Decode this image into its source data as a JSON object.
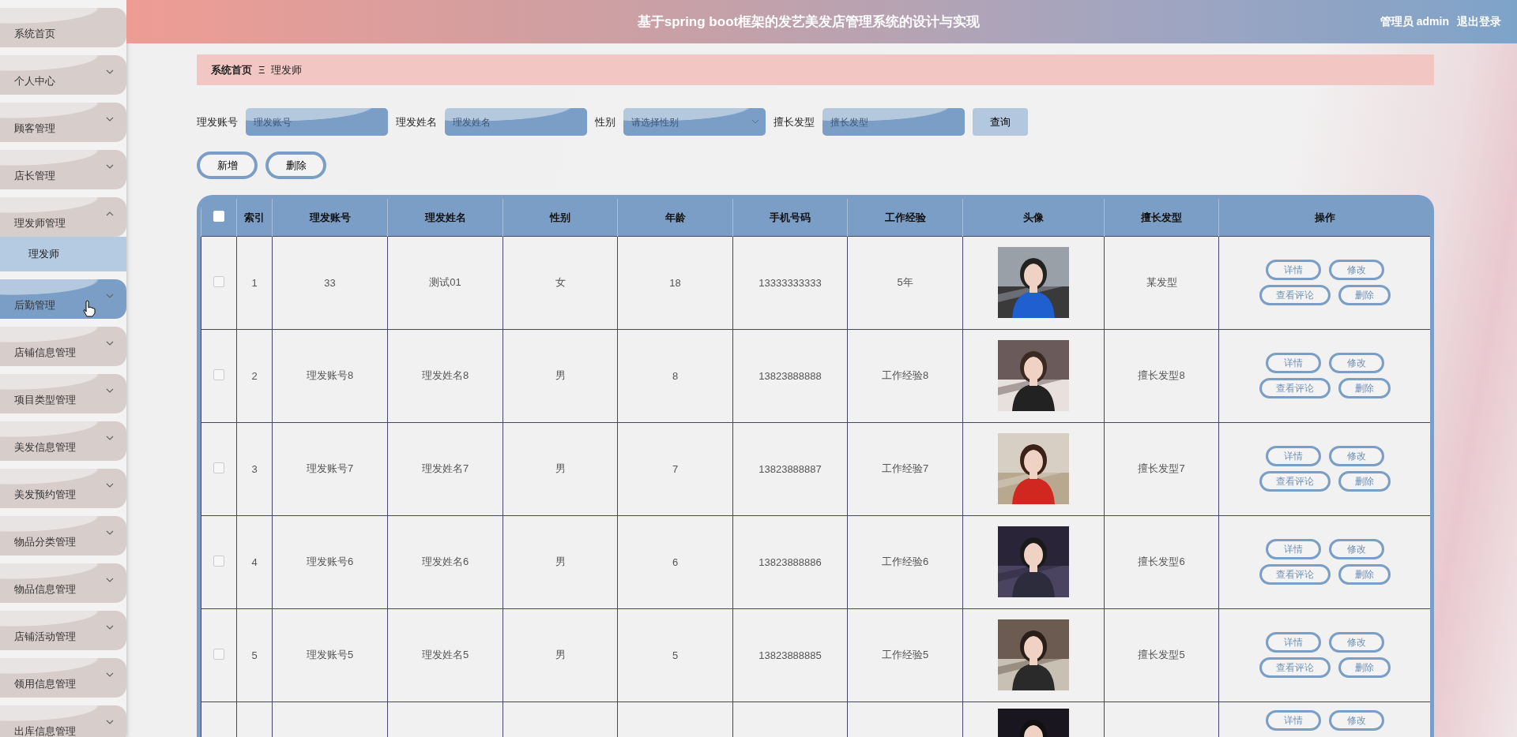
{
  "header": {
    "title": "基于spring boot框架的发艺美发店管理系统的设计与实现",
    "user": "管理员 admin",
    "logout": "退出登录"
  },
  "sidebar": {
    "items": [
      {
        "label": "系统首页",
        "kind": "link",
        "hovered": false
      },
      {
        "label": "个人中心",
        "kind": "menu",
        "expanded": false,
        "hovered": false
      },
      {
        "label": "顾客管理",
        "kind": "menu",
        "expanded": false,
        "hovered": false
      },
      {
        "label": "店长管理",
        "kind": "menu",
        "expanded": false,
        "hovered": false
      },
      {
        "label": "理发师管理",
        "kind": "menu",
        "expanded": true,
        "hovered": false,
        "children": [
          {
            "label": "理发师",
            "selected": true
          }
        ]
      },
      {
        "label": "后勤管理",
        "kind": "menu",
        "expanded": false,
        "hovered": true
      },
      {
        "label": "店铺信息管理",
        "kind": "menu",
        "expanded": false,
        "hovered": false
      },
      {
        "label": "项目类型管理",
        "kind": "menu",
        "expanded": false,
        "hovered": false
      },
      {
        "label": "美发信息管理",
        "kind": "menu",
        "expanded": false,
        "hovered": false
      },
      {
        "label": "美发预约管理",
        "kind": "menu",
        "expanded": false,
        "hovered": false
      },
      {
        "label": "物品分类管理",
        "kind": "menu",
        "expanded": false,
        "hovered": false
      },
      {
        "label": "物品信息管理",
        "kind": "menu",
        "expanded": false,
        "hovered": false
      },
      {
        "label": "店铺活动管理",
        "kind": "menu",
        "expanded": false,
        "hovered": false
      },
      {
        "label": "领用信息管理",
        "kind": "menu",
        "expanded": false,
        "hovered": false
      },
      {
        "label": "出库信息管理",
        "kind": "menu",
        "expanded": false,
        "hovered": false
      }
    ]
  },
  "breadcrumb": {
    "items": [
      "系统首页",
      "理发师"
    ],
    "separator": "Ξ"
  },
  "search": {
    "fields": [
      {
        "label": "理发账号",
        "kind": "input",
        "placeholder": "理发账号"
      },
      {
        "label": "理发姓名",
        "kind": "input",
        "placeholder": "理发姓名"
      },
      {
        "label": "性别",
        "kind": "select",
        "placeholder": "请选择性别"
      },
      {
        "label": "擅长发型",
        "kind": "input",
        "placeholder": "擅长发型"
      }
    ],
    "button": "查询"
  },
  "actions": [
    "新增",
    "删除"
  ],
  "table": {
    "columns": [
      "索引",
      "理发账号",
      "理发姓名",
      "性别",
      "年龄",
      "手机号码",
      "工作经验",
      "头像",
      "擅长发型",
      "操作"
    ],
    "select_all": {
      "checked": false
    },
    "rows": [
      {
        "checked": false,
        "cells": [
          "1",
          "33",
          "测试01",
          "女",
          "18",
          "13333333333",
          "5年"
        ],
        "style": "某发型",
        "buttons": [
          "详情",
          "修改",
          "查看评论",
          "删除"
        ]
      },
      {
        "checked": false,
        "cells": [
          "2",
          "理发账号8",
          "理发姓名8",
          "男",
          "8",
          "13823888888",
          "工作经验8"
        ],
        "style": "擅长发型8",
        "buttons": [
          "详情",
          "修改",
          "查看评论",
          "删除"
        ]
      },
      {
        "checked": false,
        "cells": [
          "3",
          "理发账号7",
          "理发姓名7",
          "男",
          "7",
          "13823888887",
          "工作经验7"
        ],
        "style": "擅长发型7",
        "buttons": [
          "详情",
          "修改",
          "查看评论",
          "删除"
        ]
      },
      {
        "checked": false,
        "cells": [
          "4",
          "理发账号6",
          "理发姓名6",
          "男",
          "6",
          "13823888886",
          "工作经验6"
        ],
        "style": "擅长发型6",
        "buttons": [
          "详情",
          "修改",
          "查看评论",
          "删除"
        ]
      },
      {
        "checked": false,
        "cells": [
          "5",
          "理发账号5",
          "理发姓名5",
          "男",
          "5",
          "13823888885",
          "工作经验5"
        ],
        "style": "擅长发型5",
        "buttons": [
          "详情",
          "修改",
          "查看评论",
          "删除"
        ]
      },
      {
        "buttons": [
          "详情",
          "修改"
        ]
      }
    ]
  }
}
